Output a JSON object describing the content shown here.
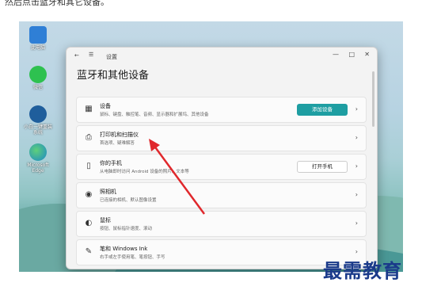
{
  "caption": "然后点击蓝牙和其它设备。",
  "desktop_icons": [
    {
      "label": "此电脑",
      "icon": "computer-icon",
      "color": "#2f7fd6"
    },
    {
      "label": "微信",
      "icon": "wechat-icon",
      "color": "#2ec150"
    },
    {
      "label": "小白一键重装系统",
      "icon": "installer-icon",
      "color": "#1f5e9c"
    },
    {
      "label": "Microsoft Edge",
      "icon": "edge-icon",
      "color": "#1b88c8"
    }
  ],
  "window": {
    "app_title": "设置",
    "heading": "蓝牙和其他设备",
    "controls": {
      "minimize": "—",
      "maximize": "□",
      "close": "✕"
    }
  },
  "cards": [
    {
      "icon": "devices-icon",
      "glyph": "▦",
      "title": "设备",
      "subtitle": "鼠标、键盘、触控笔、音频、显示器和扩展坞、其他设备",
      "button": "添加设备"
    },
    {
      "icon": "printer-icon",
      "glyph": "⎙",
      "title": "打印机和扫描仪",
      "subtitle": "首选项、疑难解答"
    },
    {
      "icon": "phone-icon",
      "glyph": "▯",
      "title": "你的手机",
      "subtitle": "从电脑即时访问 Android 设备的照片、文本等",
      "button": "打开手机"
    },
    {
      "icon": "camera-icon",
      "glyph": "◉",
      "title": "照相机",
      "subtitle": "已连接的相机、默认图像设置"
    },
    {
      "icon": "mouse-icon",
      "glyph": "◐",
      "title": "鼠标",
      "subtitle": "按钮、鼠标指针速度、滚动"
    },
    {
      "icon": "pen-icon",
      "glyph": "✎",
      "title": "笔和 Windows Ink",
      "subtitle": "右手或左手使用笔、笔按钮、手写"
    }
  ],
  "watermark": "最需教育",
  "colors": {
    "accent": "#1e9ea2",
    "arrow": "#e0282c",
    "watermark": "#1a3a8a"
  }
}
